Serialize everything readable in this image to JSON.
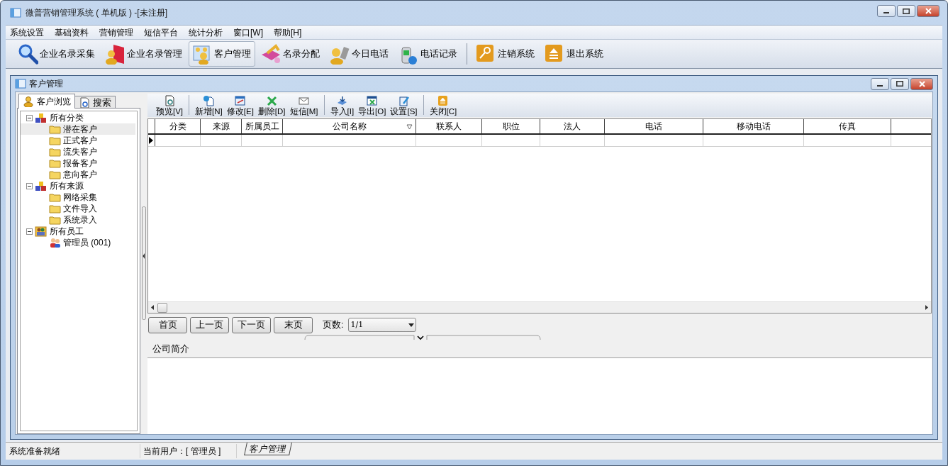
{
  "window": {
    "title": "微普营销管理系统 ( 单机版 ) -[未注册]"
  },
  "menu": [
    "系统设置",
    "基础资料",
    "营销管理",
    "短信平台",
    "统计分析",
    "窗口[W]",
    "帮助[H]"
  ],
  "toolbar": [
    {
      "kind": "search",
      "label": "企业名录采集",
      "selected": false,
      "separator_before": false
    },
    {
      "kind": "book",
      "label": "企业名录管理",
      "selected": false,
      "separator_before": false
    },
    {
      "kind": "people",
      "label": "客户管理",
      "selected": true,
      "separator_before": false
    },
    {
      "kind": "share",
      "label": "名录分配",
      "selected": false,
      "separator_before": false
    },
    {
      "kind": "phone-person",
      "label": "今日电话",
      "selected": false,
      "separator_before": false
    },
    {
      "kind": "mobile",
      "label": "电话记录",
      "selected": false,
      "separator_before": false
    },
    {
      "kind": "key",
      "label": "注销系统",
      "selected": false,
      "separator_before": true
    },
    {
      "kind": "eject",
      "label": "退出系统",
      "selected": false,
      "separator_before": false
    }
  ],
  "child": {
    "title": "客户管理",
    "left_tabs": [
      {
        "kind": "person",
        "label": "客户浏览",
        "selected": true
      },
      {
        "kind": "search",
        "label": "搜索",
        "selected": false
      }
    ],
    "tree": [
      {
        "kind": "group",
        "label": "所有分类",
        "expanded": true,
        "children": [
          {
            "kind": "folder",
            "label": "潜在客户",
            "selected": true
          },
          {
            "kind": "folder",
            "label": "正式客户",
            "selected": false
          },
          {
            "kind": "folder",
            "label": "流失客户",
            "selected": false
          },
          {
            "kind": "folder",
            "label": "报备客户",
            "selected": false
          },
          {
            "kind": "folder",
            "label": "意向客户",
            "selected": false
          }
        ]
      },
      {
        "kind": "group",
        "label": "所有来源",
        "expanded": true,
        "children": [
          {
            "kind": "folder",
            "label": "网络采集",
            "selected": false
          },
          {
            "kind": "folder",
            "label": "文件导入",
            "selected": false
          },
          {
            "kind": "folder",
            "label": "系统录入",
            "selected": false
          }
        ]
      },
      {
        "kind": "staff",
        "label": "所有员工",
        "expanded": true,
        "children": [
          {
            "kind": "user",
            "label": "管理员 (001)",
            "selected": false
          }
        ]
      }
    ],
    "grid_toolbar": [
      {
        "kind": "preview",
        "label": "预览[V]",
        "separator_before": false
      },
      {
        "kind": "new",
        "label": "新增[N]",
        "separator_before": true
      },
      {
        "kind": "edit",
        "label": "修改[E]",
        "separator_before": false
      },
      {
        "kind": "delete",
        "label": "删除[D]",
        "separator_before": false
      },
      {
        "kind": "mail",
        "label": "短信[M]",
        "separator_before": false
      },
      {
        "kind": "import",
        "label": "导入[I]",
        "separator_before": true
      },
      {
        "kind": "export",
        "label": "导出[O]",
        "separator_before": false
      },
      {
        "kind": "settings",
        "label": "设置[S]",
        "separator_before": false
      },
      {
        "kind": "close",
        "label": "关闭[C]",
        "separator_before": true
      }
    ],
    "columns": [
      {
        "label": "分类",
        "sorted": false
      },
      {
        "label": "来源",
        "sorted": false
      },
      {
        "label": "所属员工",
        "sorted": false
      },
      {
        "label": "公司名称",
        "sorted": true
      },
      {
        "label": "联系人",
        "sorted": false
      },
      {
        "label": "职位",
        "sorted": false
      },
      {
        "label": "法人",
        "sorted": false
      },
      {
        "label": "电话",
        "sorted": false
      },
      {
        "label": "移动电话",
        "sorted": false
      },
      {
        "label": "传真",
        "sorted": false
      }
    ],
    "pager": {
      "buttons": [
        "首页",
        "上一页",
        "下一页",
        "末页"
      ],
      "page_label": "页数:",
      "page_value": "1/1"
    },
    "memo": {
      "label": "公司简介"
    }
  },
  "status_bar": {
    "message": "系统准备就绪",
    "user": "当前用户：[ 管理员 ]",
    "tab": "客户管理"
  }
}
